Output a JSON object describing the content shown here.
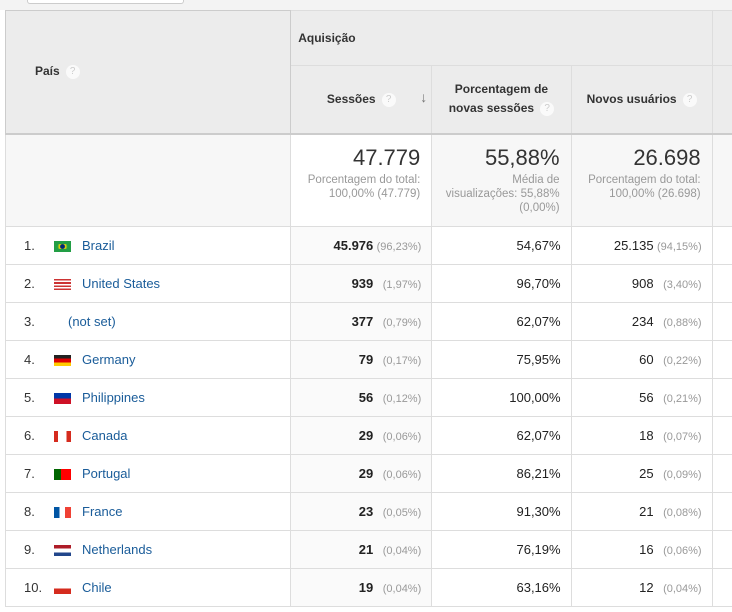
{
  "header": {
    "country": "País",
    "group": "Aquisição",
    "sessions": "Sessões",
    "new_sessions_line1": "Porcentagem de",
    "new_sessions_line2": "novas sessões",
    "new_users": "Novos usuários",
    "help": "?",
    "sort_icon": "arrow-down-icon"
  },
  "totals": {
    "sessions": "47.779",
    "sessions_note1": "Porcentagem do total:",
    "sessions_note2": "100,00% (47.779)",
    "new_sessions": "55,88%",
    "new_sessions_note1": "Média de",
    "new_sessions_note2": "visualizações: 55,88%",
    "new_sessions_note3": "(0,00%)",
    "new_users": "26.698",
    "new_users_note1": "Porcentagem do total:",
    "new_users_note2": "100,00% (26.698)"
  },
  "rows": [
    {
      "idx": "1.",
      "country": "Brazil",
      "flag": "brazil-flag",
      "sessions": "45.976",
      "sessions_pct": "(96,23%)",
      "new_sessions": "54,67%",
      "new_users": "25.135",
      "new_users_pct": "(94,15%)"
    },
    {
      "idx": "2.",
      "country": "United States",
      "flag": "us-flag",
      "sessions": "939",
      "sessions_pct": "(1,97%)",
      "new_sessions": "96,70%",
      "new_users": "908",
      "new_users_pct": "(3,40%)"
    },
    {
      "idx": "3.",
      "country": "(not set)",
      "flag": "",
      "sessions": "377",
      "sessions_pct": "(0,79%)",
      "new_sessions": "62,07%",
      "new_users": "234",
      "new_users_pct": "(0,88%)"
    },
    {
      "idx": "4.",
      "country": "Germany",
      "flag": "germany-flag",
      "sessions": "79",
      "sessions_pct": "(0,17%)",
      "new_sessions": "75,95%",
      "new_users": "60",
      "new_users_pct": "(0,22%)"
    },
    {
      "idx": "5.",
      "country": "Philippines",
      "flag": "philippines-flag",
      "sessions": "56",
      "sessions_pct": "(0,12%)",
      "new_sessions": "100,00%",
      "new_users": "56",
      "new_users_pct": "(0,21%)"
    },
    {
      "idx": "6.",
      "country": "Canada",
      "flag": "canada-flag",
      "sessions": "29",
      "sessions_pct": "(0,06%)",
      "new_sessions": "62,07%",
      "new_users": "18",
      "new_users_pct": "(0,07%)"
    },
    {
      "idx": "7.",
      "country": "Portugal",
      "flag": "portugal-flag",
      "sessions": "29",
      "sessions_pct": "(0,06%)",
      "new_sessions": "86,21%",
      "new_users": "25",
      "new_users_pct": "(0,09%)"
    },
    {
      "idx": "8.",
      "country": "France",
      "flag": "france-flag",
      "sessions": "23",
      "sessions_pct": "(0,05%)",
      "new_sessions": "91,30%",
      "new_users": "21",
      "new_users_pct": "(0,08%)"
    },
    {
      "idx": "9.",
      "country": "Netherlands",
      "flag": "netherlands-flag",
      "sessions": "21",
      "sessions_pct": "(0,04%)",
      "new_sessions": "76,19%",
      "new_users": "16",
      "new_users_pct": "(0,06%)"
    },
    {
      "idx": "10.",
      "country": "Chile",
      "flag": "chile-flag",
      "sessions": "19",
      "sessions_pct": "(0,04%)",
      "new_sessions": "63,16%",
      "new_users": "12",
      "new_users_pct": "(0,04%)"
    }
  ]
}
